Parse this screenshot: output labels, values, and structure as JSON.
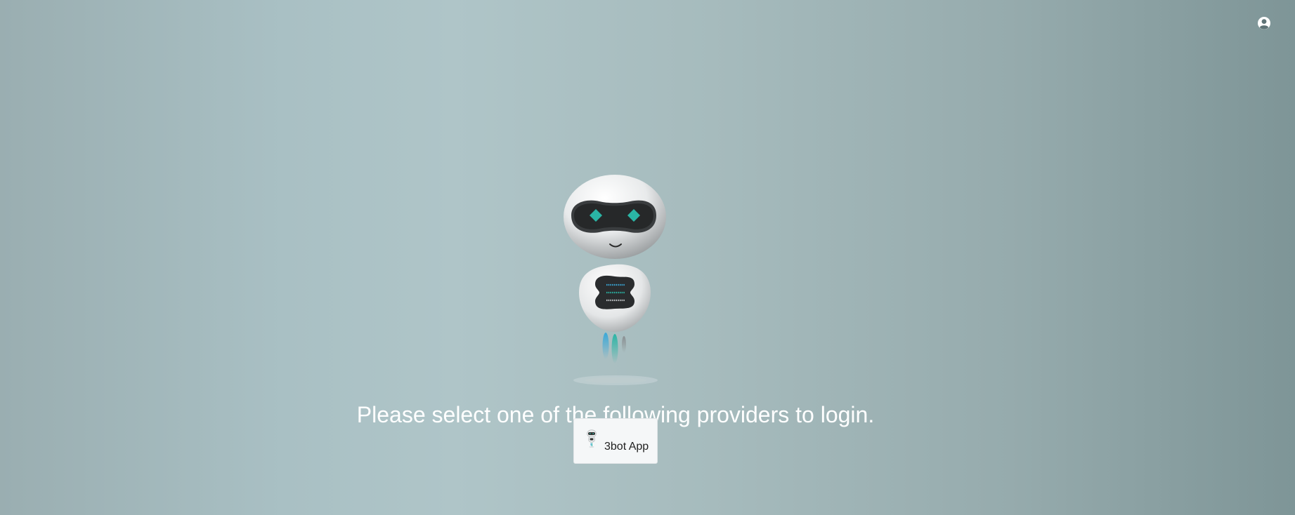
{
  "header": {
    "account_icon": "user-circle-icon"
  },
  "hero": {
    "illustration": "robot-mascot-image",
    "headline": "Please select one of the following providers to login."
  },
  "providers": [
    {
      "label": "3bot App",
      "icon": "robot-mini-icon"
    }
  ],
  "colors": {
    "headline_text": "#ffffff",
    "button_background": "#f5f7f8",
    "robot_accent_teal": "#2ab5a5",
    "robot_accent_blue": "#3aa8d8"
  }
}
